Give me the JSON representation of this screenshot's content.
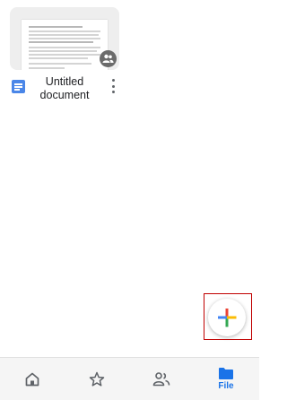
{
  "document": {
    "title": "Untitled\ndocument",
    "icon": "google-docs-icon",
    "shared_icon": "people-icon",
    "menu_icon": "more-vert-icon"
  },
  "fab": {
    "icon": "add-plus-icon",
    "colors": [
      "#ea4335",
      "#4285f4",
      "#fbbc04",
      "#34a853"
    ]
  },
  "bottom_nav": {
    "items": [
      {
        "icon": "home-icon",
        "label": ""
      },
      {
        "icon": "star-icon",
        "label": ""
      },
      {
        "icon": "shared-people-icon",
        "label": ""
      },
      {
        "icon": "folder-icon",
        "label": "File",
        "active": true
      }
    ]
  },
  "colors": {
    "accent": "#1a73e8",
    "highlight_box": "#c00000"
  }
}
